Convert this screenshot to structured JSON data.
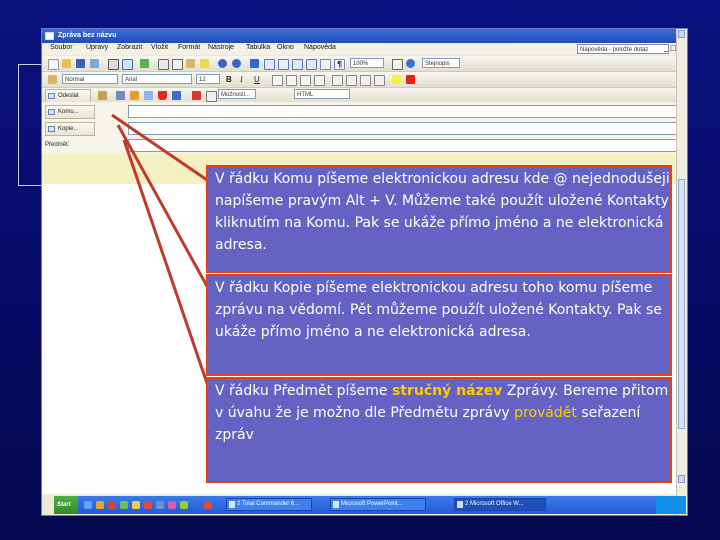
{
  "window": {
    "title": "Zpráva bez názvu",
    "controls": [
      "_",
      "□",
      "×"
    ]
  },
  "menubar": {
    "items": [
      "Soubor",
      "Úpravy",
      "Zobrazit",
      "Vložit",
      "Formát",
      "Nástroje",
      "Tabulka",
      "Okno",
      "Nápověda"
    ],
    "help_placeholder": "Nápověda - položte dotaz"
  },
  "toolbar": {
    "zoom": "100%",
    "font_size": "12",
    "style": "Normal",
    "font": "Arial",
    "options_label": "Možnosti...",
    "html_format": "HTML",
    "format_combo": "Stejnopis"
  },
  "header": {
    "send_label": "Odeslat",
    "to_button": "Komu...",
    "cc_button": "Kopie...",
    "subject_label": "Předmět:"
  },
  "taskbar": {
    "start": "Start",
    "tasks": [
      "2 Total Commander 6...",
      "Microsoft PowerPoint...",
      "2 Microsoft Office W..."
    ]
  },
  "callouts": [
    {
      "text": "V řádku Komu píšeme elektronickou adresu kde @ nejednodušeji napíšeme pravým Alt + V. Můžeme také použít uložené Kontakty kliknutím na Komu. Pak se ukáže přímo jméno a ne elektronická adresa."
    },
    {
      "text": "V řádku Kopie píšeme elektronickou adresu toho komu píšeme zprávu na vědomí. Pět můžeme použít uložené Kontakty. Pak se ukáže přímo jméno a ne elektronická adresa."
    },
    {
      "before": "V řádku Předmět píšeme ",
      "emphasis": "stručný název",
      "middle": " Zprávy. Bereme přitom v úvahu že je možno dle Předmětu zprávy ",
      "highlight": "provádět",
      "after": " seřazení zpráv"
    }
  ],
  "colors": {
    "slide_background": "#060d6e",
    "callout_fill": "#6463c3",
    "callout_border": "#e0421c",
    "pointer_line": "#c0392b",
    "highlight": "#ffcc00"
  }
}
